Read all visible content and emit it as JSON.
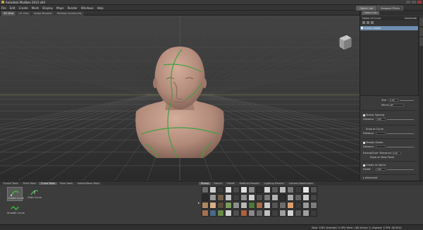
{
  "window": {
    "title": "Autodesk Mudbox 2013 x64"
  },
  "menu": {
    "items": [
      "File",
      "Edit",
      "Create",
      "Mesh",
      "Display",
      "Maps",
      "Render",
      "Windows",
      "Help"
    ],
    "right_tabs": [
      "Object List",
      "Viewport Filters"
    ]
  },
  "view_tabs": [
    "3D View",
    "UV View",
    "Image Browser",
    "Mudbox Community"
  ],
  "right_panel": {
    "tabs": [
      "Object List"
    ],
    "columns": [
      "Name of Curve",
      "Subdivide"
    ],
    "rows": [
      {
        "label": "Curve Create",
        "selected": true
      }
    ]
  },
  "properties": {
    "size_label": "Size",
    "size_value": "2.00",
    "mirror_label": "Mirror",
    "mirror_value": "Off",
    "stamp_spacing_label": "Stamp Spacing",
    "stamp_spacing_checked": true,
    "distance_label": "Distance",
    "distance_value": "100",
    "snap_label": "Snap to Curve",
    "snap_checked": false,
    "distance2_label": "Distance",
    "distance2_value": "",
    "steady_label": "Steady Stroke",
    "steady_checked": true,
    "distance3_label": "Distance",
    "distance3_value": "",
    "extend_label": "Extend/Over Tolerance",
    "extend_value": "0.00",
    "draw_label": "Draw on New Plane",
    "create_label": "Create as Spline",
    "create_checked": true,
    "falloff_label": "Falloff",
    "falloff_value": "150",
    "advanced_label": "Advanced"
  },
  "bottom_tabs": [
    "Sculpt Tools",
    "Paint Tools",
    "Curve Tools",
    "Pose Tools",
    "Select/Move Tools"
  ],
  "bottom_active": "Curve Tools",
  "curve_tools": [
    {
      "label": "Create Curve",
      "icon": "create-curve-icon",
      "selected": true
    },
    {
      "label": "Grab Curve",
      "icon": "grab-curve-icon",
      "selected": false
    },
    {
      "label": "Smooth Curve",
      "icon": "smooth-curve-icon",
      "selected": false
    }
  ],
  "stamp_tabs": [
    "Stamp",
    "Stencil",
    "Falloff",
    "Material Presets",
    "Lighting Presets",
    "Camera Bookmarks"
  ],
  "stamp_active": "Stamp",
  "status": {
    "text": "Total: 3581 Selected: 0 GPU Mem: 180 Active: 0, Highest: 0 FPS: 60.0041"
  },
  "colors": {
    "viewport_top": "#3f3f3f",
    "viewport_bottom": "#2b2b2b",
    "grid_line": "#5a5a5a",
    "horizon_line": "#8c8c3c",
    "skin": "#b89080",
    "curve": "#3fa13f",
    "selection": "#6e8eb0"
  },
  "stamp_colors": [
    "#6a6a6a",
    "#cfcfcf",
    "#3a3a3a",
    "#d8d8d8",
    "#4a4a4a",
    "#e0e0e0",
    "#8a8a8a",
    "#2e2e2e",
    "#d4d4d4",
    "#5c5c5c",
    "#bcbcbc",
    "#777777",
    "#3a3a3a",
    "#e5e5e5",
    "#555555",
    "#2a2a2a",
    "#9a9a9a",
    "#6f5e4a",
    "#c2c2c2",
    "#3e3e3e",
    "#8f8f8f",
    "#d0d0d0",
    "#4e4e4e",
    "#7a7a7a",
    "#b3b3b3",
    "#2f2f2f",
    "#a8a8a8",
    "#606060",
    "#cccccc",
    "#464646",
    "#b08860",
    "#d6b08a",
    "#5c4a3a",
    "#7a9c5a",
    "#8e8e8e",
    "#b8b8b8",
    "#4c7a3e",
    "#a36a4a",
    "#c8c8c8",
    "#555555",
    "#6d6d6d",
    "#d8a070",
    "#3a3a3a",
    "#9a9a9a",
    "#7c7c7c",
    "#a87050",
    "#4a6a8a",
    "#6a8a4a",
    "#cfcfcf",
    "#505050",
    "#b06040",
    "#8a8a8a",
    "#6a6a6a",
    "#c0c0c0",
    "#404040",
    "#9e9e9e",
    "#d2d2d2",
    "#585858",
    "#a0a0a0",
    "#3c3c3c"
  ]
}
